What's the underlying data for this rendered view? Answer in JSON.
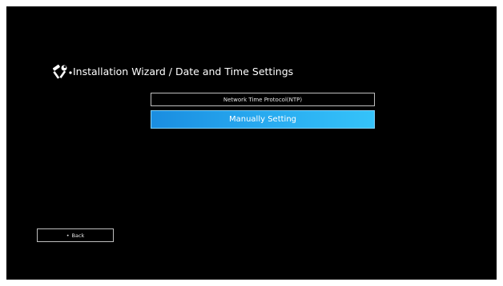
{
  "header": {
    "icon": "tools-icon",
    "title": "Installation Wizard / Date and Time Settings"
  },
  "options": {
    "ntp_label": "Network Time Protocol(NTP)",
    "manual_label": "Manually Setting",
    "selected": "Manually Setting"
  },
  "footer": {
    "back_bullet": "•",
    "back_label": "Back"
  },
  "colors": {
    "background": "#000000",
    "accent": "#27a7ee",
    "text": "#ffffff"
  }
}
